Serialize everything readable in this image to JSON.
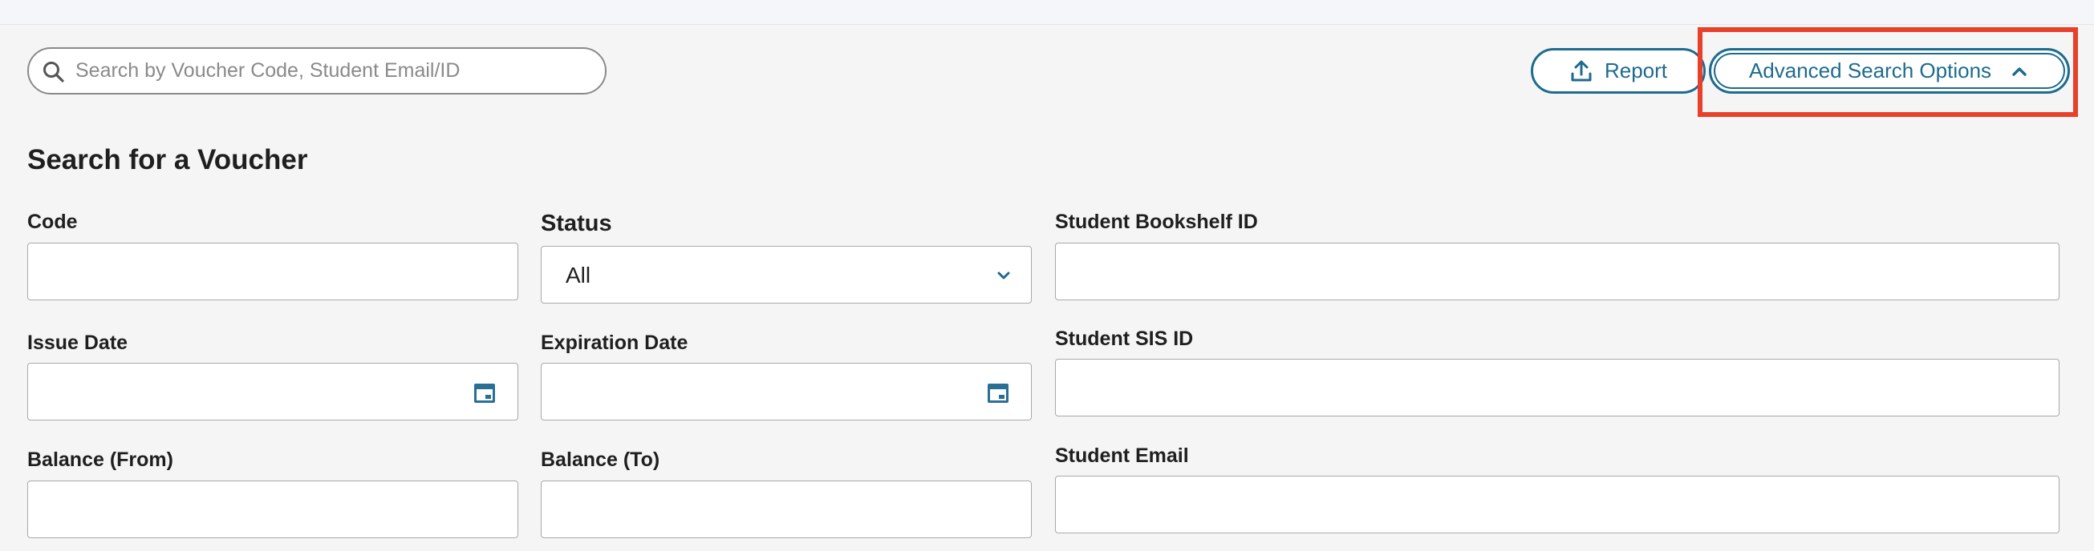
{
  "search": {
    "placeholder": "Search by Voucher Code, Student Email/ID"
  },
  "toolbar": {
    "report_label": "Report",
    "advanced_label": "Advanced Search Options"
  },
  "form": {
    "title": "Search for a Voucher",
    "code_label": "Code",
    "status_label": "Status",
    "status_value": "All",
    "bookshelf_label": "Student Bookshelf ID",
    "issue_date_label": "Issue Date",
    "expiration_date_label": "Expiration Date",
    "sis_label": "Student SIS ID",
    "balance_from_label": "Balance (From)",
    "balance_to_label": "Balance (To)",
    "email_label": "Student Email"
  },
  "colors": {
    "accent": "#1d6b8e",
    "highlight": "#e8402a"
  },
  "icons": {
    "search": "search-icon",
    "report": "upload-icon",
    "advanced": "chevron-up-icon",
    "status": "chevron-down-icon",
    "date": "calendar-icon"
  }
}
